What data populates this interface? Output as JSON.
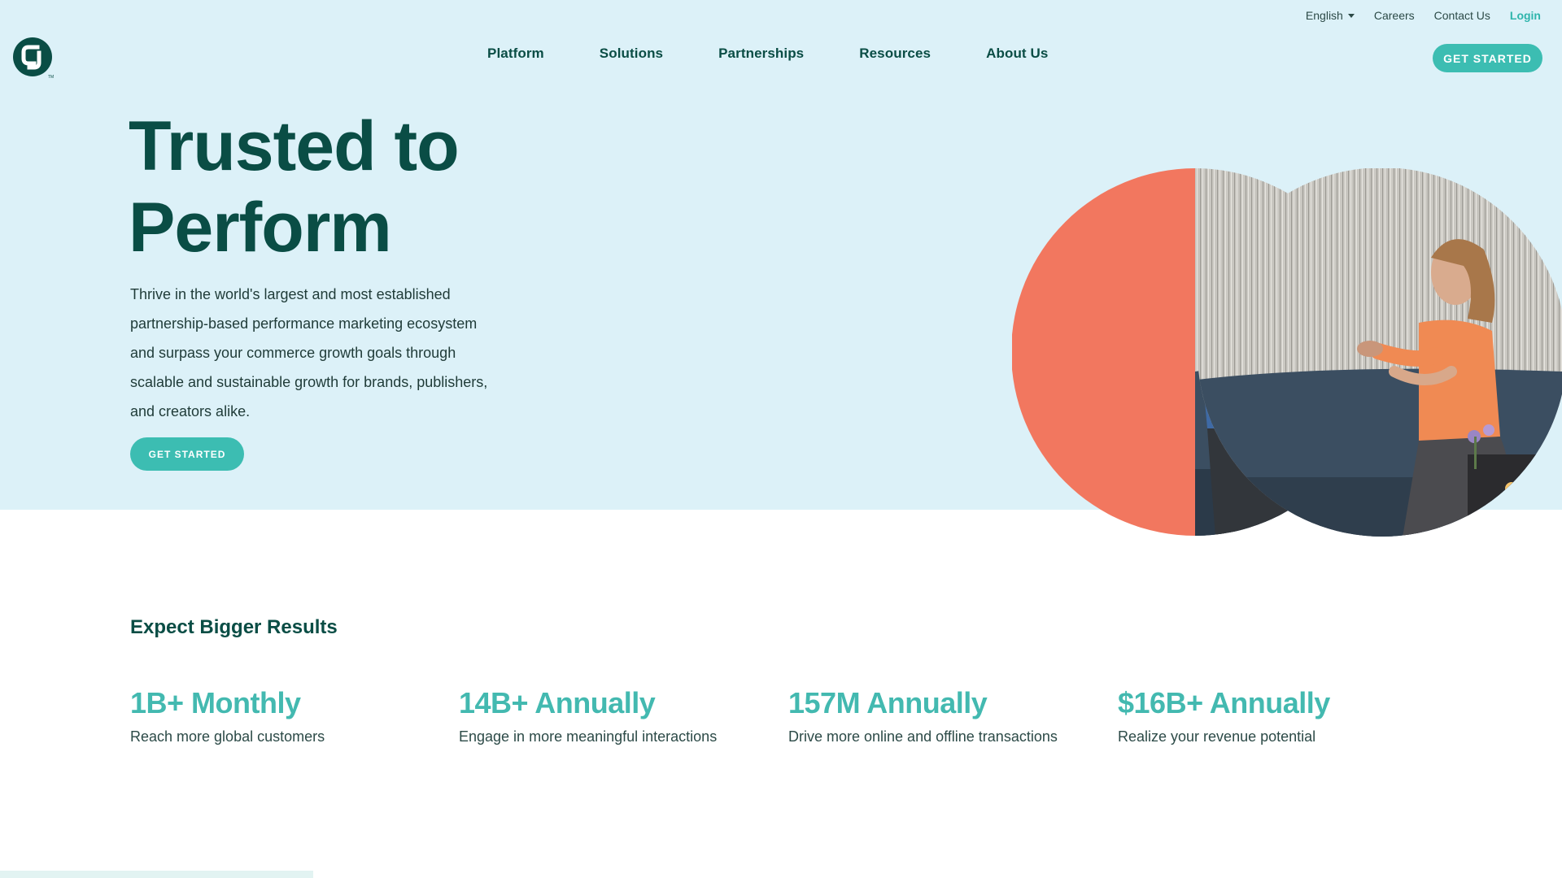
{
  "utility_nav": {
    "language": "English",
    "careers": "Careers",
    "contact": "Contact Us",
    "login": "Login"
  },
  "logo": {
    "icon": "cj-logo-icon",
    "trademark": "TM"
  },
  "main_nav": {
    "items": [
      {
        "label": "Platform"
      },
      {
        "label": "Solutions"
      },
      {
        "label": "Partnerships"
      },
      {
        "label": "Resources"
      },
      {
        "label": "About Us"
      }
    ]
  },
  "header": {
    "cta_label": "GET STARTED"
  },
  "hero": {
    "title_line1": "Trusted to",
    "title_line2": "Perform",
    "description": "Thrive in the world's largest and most established partnership-based performance marketing ecosystem and surpass your commerce growth goals through scalable and sustainable growth for brands, publishers, and creators alike.",
    "cta_label": "GET STARTED",
    "image": "hero-people-talking-photo"
  },
  "results": {
    "heading": "Expect Bigger Results",
    "stats": [
      {
        "value": "1B+ Monthly",
        "label": "Reach more global customers"
      },
      {
        "value": "14B+ Annually",
        "label": "Engage in more meaningful interactions"
      },
      {
        "value": "157M Annually",
        "label": "Drive more online and offline transactions"
      },
      {
        "value": "$16B+ Annually",
        "label": "Realize your revenue potential"
      }
    ]
  },
  "colors": {
    "hero_background": "#dcf1f8",
    "brand_dark": "#0a4d45",
    "accent_teal": "#3cbdb2",
    "coral": "#f2775f"
  }
}
